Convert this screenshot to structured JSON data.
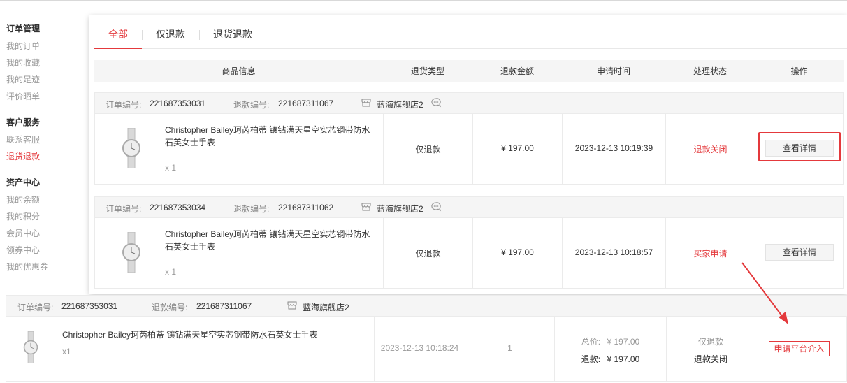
{
  "sidebar": {
    "groups": [
      {
        "title": "订单管理",
        "items": [
          "我的订单",
          "我的收藏",
          "我的足迹",
          "评价晒单"
        ]
      },
      {
        "title": "客户服务",
        "items": [
          "联系客服",
          "退货退款"
        ]
      },
      {
        "title": "资产中心",
        "items": [
          "我的余额",
          "我的积分",
          "会员中心",
          "领券中心",
          "我的优惠券"
        ]
      }
    ],
    "active_item": "退货退款"
  },
  "tabs": [
    "全部",
    "仅退款",
    "退货退款"
  ],
  "active_tab": "全部",
  "table_headers": [
    "商品信息",
    "退货类型",
    "退款金额",
    "申请时间",
    "处理状态",
    "操作"
  ],
  "labels": {
    "order_no": "订单编号:",
    "refund_no": "退款编号:",
    "detail_button": "查看详情",
    "total_label": "总价:",
    "refund_label": "退款:",
    "platform_button": "申请平台介入"
  },
  "orders": [
    {
      "order_no": "221687353031",
      "refund_no": "221687311067",
      "shop": "蓝海旗舰店2",
      "product": "Christopher Bailey珂芮柏蒂 镶钻满天星空实芯钢带防水石英女士手表",
      "qty": "x 1",
      "type": "仅退款",
      "amount": "¥ 197.00",
      "time": "2023-12-13 10:19:39",
      "status": "退款关闭"
    },
    {
      "order_no": "221687353034",
      "refund_no": "221687311062",
      "shop": "蓝海旗舰店2",
      "product": "Christopher Bailey珂芮柏蒂 镶钻满天星空实芯钢带防水石英女士手表",
      "qty": "x 1",
      "type": "仅退款",
      "amount": "¥ 197.00",
      "time": "2023-12-13 10:18:57",
      "status": "买家申请"
    }
  ],
  "bottom_order": {
    "order_no": "221687353031",
    "refund_no": "221687311067",
    "shop": "蓝海旗舰店2",
    "product": "Christopher Bailey珂芮柏蒂 镶钻满天星空实芯钢带防水石英女士手表",
    "qty": "x1",
    "time": "2023-12-13 10:18:24",
    "count": "1",
    "total": "¥ 197.00",
    "refund": "¥ 197.00",
    "type": "仅退款",
    "status": "退款关闭"
  },
  "colors": {
    "accent": "#e4393c",
    "header_bg": "#f5f5f5",
    "muted": "#999999"
  }
}
